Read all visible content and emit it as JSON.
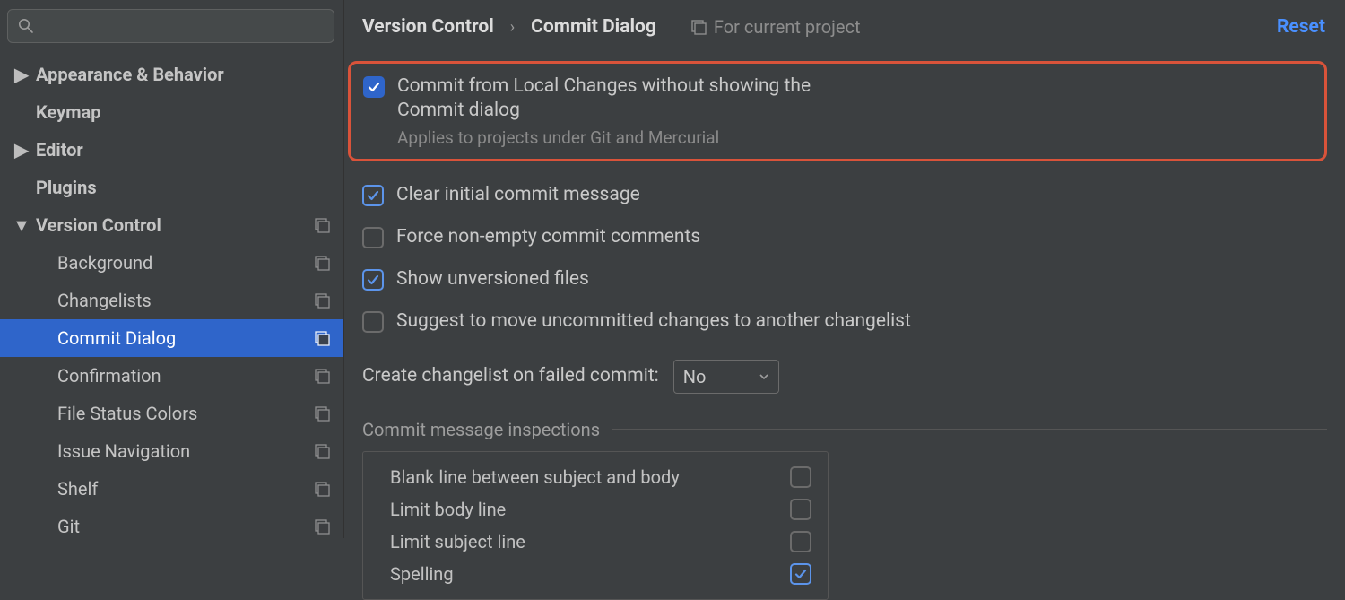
{
  "sidebar": {
    "items": [
      {
        "label": "Appearance & Behavior",
        "expandable": true,
        "expanded": false,
        "proj": false,
        "level": 0
      },
      {
        "label": "Keymap",
        "expandable": false,
        "proj": false,
        "level": 0
      },
      {
        "label": "Editor",
        "expandable": true,
        "expanded": false,
        "proj": false,
        "level": 0
      },
      {
        "label": "Plugins",
        "expandable": false,
        "proj": false,
        "level": 0
      },
      {
        "label": "Version Control",
        "expandable": true,
        "expanded": true,
        "proj": true,
        "level": 0
      },
      {
        "label": "Background",
        "proj": true,
        "level": 1
      },
      {
        "label": "Changelists",
        "proj": true,
        "level": 1
      },
      {
        "label": "Commit Dialog",
        "proj": true,
        "level": 1,
        "selected": true
      },
      {
        "label": "Confirmation",
        "proj": true,
        "level": 1
      },
      {
        "label": "File Status Colors",
        "proj": true,
        "level": 1
      },
      {
        "label": "Issue Navigation",
        "proj": true,
        "level": 1
      },
      {
        "label": "Shelf",
        "proj": true,
        "level": 1
      },
      {
        "label": "Git",
        "proj": true,
        "level": 1
      }
    ]
  },
  "header": {
    "crumb1": "Version Control",
    "crumb2": "Commit Dialog",
    "for_project": "For current project",
    "reset": "Reset"
  },
  "options": {
    "commit_local": {
      "label": "Commit from Local Changes without showing the Commit dialog",
      "sub": "Applies to projects under Git and Mercurial",
      "checked": true
    },
    "clear_msg": {
      "label": "Clear initial commit message",
      "checked": true
    },
    "force_nonempty": {
      "label": "Force non-empty commit comments",
      "checked": false
    },
    "show_unversioned": {
      "label": "Show unversioned files",
      "checked": true
    },
    "suggest_move": {
      "label": "Suggest to move uncommitted changes to another changelist",
      "checked": false
    },
    "create_changelist_label": "Create changelist on failed commit:",
    "create_changelist_value": "No"
  },
  "inspections": {
    "legend": "Commit message inspections",
    "rows": [
      {
        "label": "Blank line between subject and body",
        "checked": false
      },
      {
        "label": "Limit body line",
        "checked": false
      },
      {
        "label": "Limit subject line",
        "checked": false
      },
      {
        "label": "Spelling",
        "checked": true
      }
    ]
  }
}
